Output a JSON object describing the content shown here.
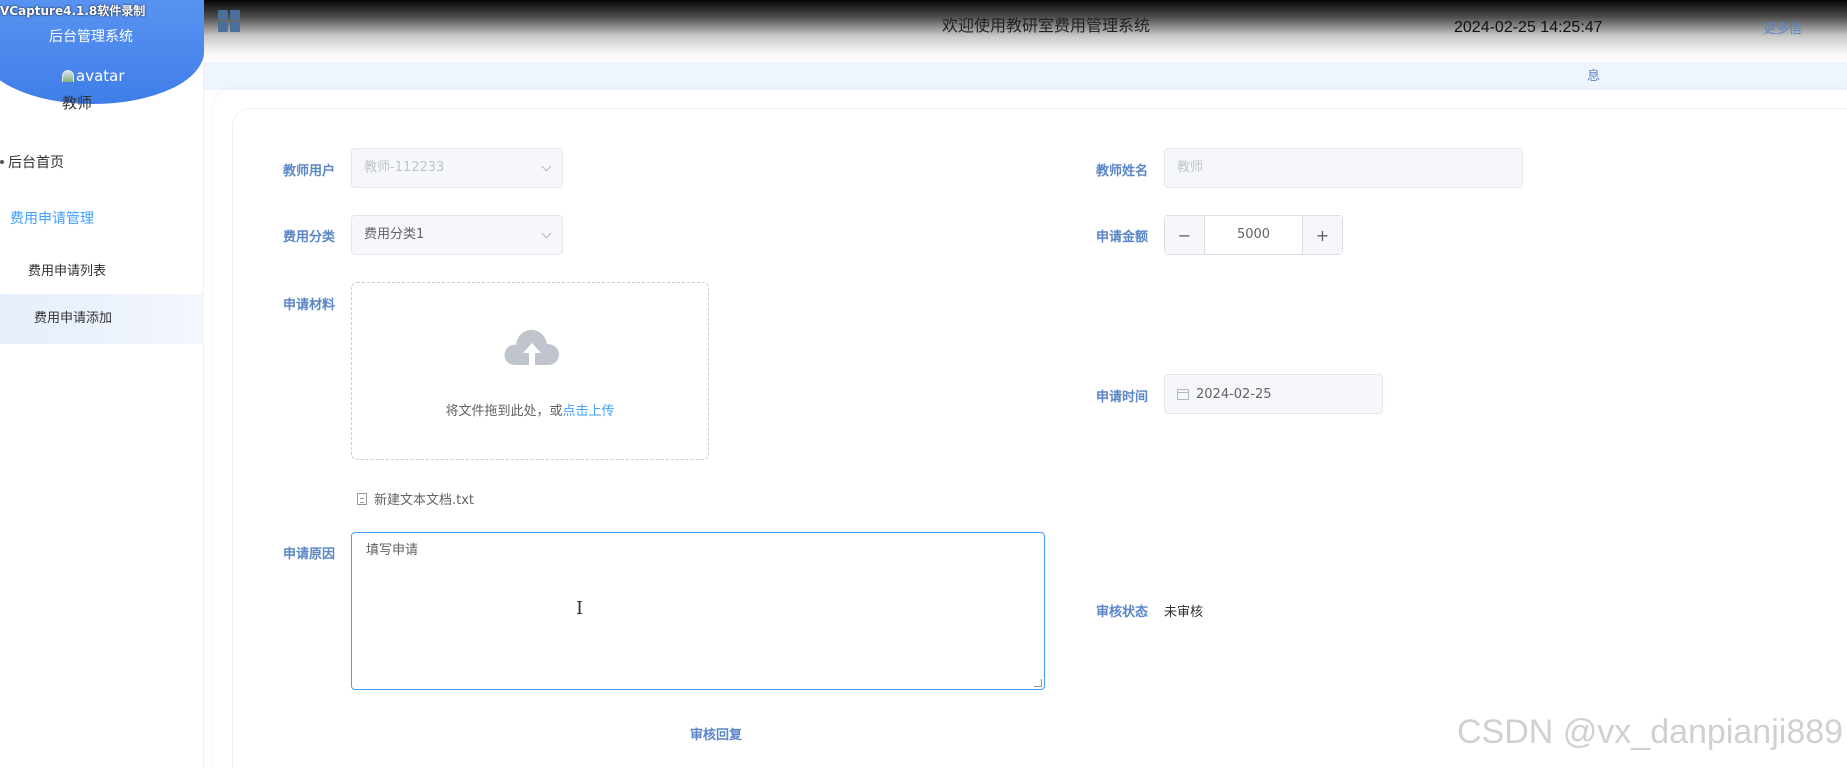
{
  "app": {
    "recorder_watermark": "VCapture4.1.8软件录制",
    "title": "后台管理系统",
    "avatar_alt": "avatar",
    "role": "教师",
    "welcome": "欢迎使用教研室费用管理系统",
    "datetime": "2024-02-25 14:25:47",
    "more_info_line1": "更多信",
    "more_info_line2": "息"
  },
  "sidebar": {
    "home": "后台首页",
    "group": "费用申请管理",
    "items": [
      {
        "label": "费用申请列表"
      },
      {
        "label": "费用申请添加"
      }
    ]
  },
  "form": {
    "teacher_user": {
      "label": "教师用户",
      "value": "教师-112233"
    },
    "teacher_name": {
      "label": "教师姓名",
      "placeholder": "教师"
    },
    "category": {
      "label": "费用分类",
      "value": "费用分类1"
    },
    "amount": {
      "label": "申请金额",
      "value": "5000",
      "minus": "−",
      "plus": "+"
    },
    "material": {
      "label": "申请材料",
      "drag_text": "将文件拖到此处，或",
      "click_upload": "点击上传",
      "file_name": "新建文本文档.txt"
    },
    "apply_time": {
      "label": "申请时间",
      "value": "2024-02-25"
    },
    "reason": {
      "label": "申请原因",
      "value": "填写申请"
    },
    "audit_status": {
      "label": "审核状态",
      "value": "未审核"
    },
    "audit_reply": {
      "label": "审核回复"
    }
  },
  "watermark": "CSDN @vx_danpianji889",
  "colors": {
    "accent": "#409eff",
    "label": "#5b86c7",
    "sidebar_header": "#4f8cf0"
  }
}
